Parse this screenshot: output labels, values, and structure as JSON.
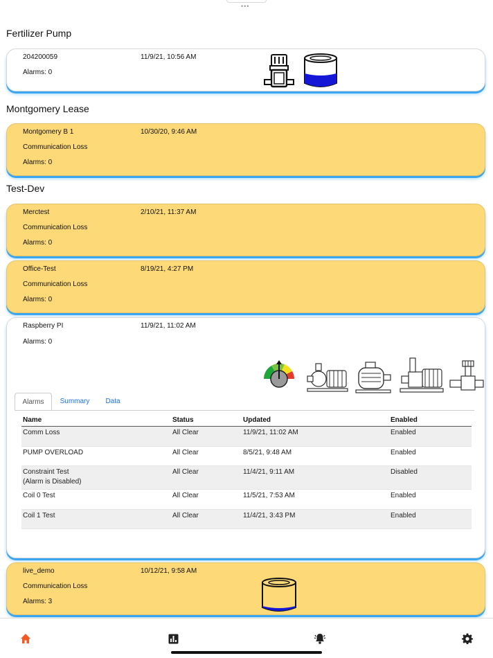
{
  "colors": {
    "warn_bg": "#fdd978",
    "accent": "#39a6ef",
    "nav_active": "#f15a24",
    "link": "#1a73e8"
  },
  "groups": [
    {
      "title": "Fertilizer Pump"
    },
    {
      "title": "Montgomery Lease"
    },
    {
      "title": "Test-Dev"
    }
  ],
  "devices": {
    "fertilizer": {
      "name": "204200059",
      "time": "11/9/21, 10:56 AM",
      "alarms": "Alarms: 0",
      "icons": [
        "vertical-pump-icon",
        "tank-icon"
      ]
    },
    "montgomery": {
      "name": "Montgomery B 1",
      "time": "10/30/20, 9:46 AM",
      "status": "Communication Loss",
      "alarms": "Alarms: 0"
    },
    "merctest": {
      "name": "Merctest",
      "time": "2/10/21, 11:37 AM",
      "status": "Communication Loss",
      "alarms": "Alarms: 0"
    },
    "office": {
      "name": "Office-Test",
      "time": "8/19/21, 4:27 PM",
      "status": "Communication Loss",
      "alarms": "Alarms: 0"
    },
    "raspberry": {
      "name": "Raspberry PI",
      "time": "11/9/21, 11:02 AM",
      "alarms": "Alarms: 0",
      "icons": [
        "gauge-icon",
        "centrifugal-pump-icon",
        "motor-icon",
        "skid-pump-icon",
        "valve-icon"
      ],
      "tabs": [
        "Alarms",
        "Summary",
        "Data"
      ],
      "active_tab": "Alarms",
      "table": {
        "headers": [
          "Name",
          "Status",
          "Updated",
          "Enabled"
        ],
        "rows": [
          {
            "name": "Comm Loss",
            "sub": "",
            "status": "All Clear",
            "updated": "11/9/21, 11:02 AM",
            "enabled": "Enabled"
          },
          {
            "name": "PUMP OVERLOAD",
            "sub": "",
            "status": "All Clear",
            "updated": "8/5/21, 9:48 AM",
            "enabled": "Enabled"
          },
          {
            "name": "Constraint Test",
            "sub": "(Alarm is Disabled)",
            "status": "All Clear",
            "updated": "11/4/21, 9:11 AM",
            "enabled": "Disabled"
          },
          {
            "name": "Coil 0 Test",
            "sub": "",
            "status": "All Clear",
            "updated": "11/5/21, 7:53 AM",
            "enabled": "Enabled"
          },
          {
            "name": "Coil 1 Test",
            "sub": "",
            "status": "All Clear",
            "updated": "11/4/21, 3:43 PM",
            "enabled": "Enabled"
          }
        ]
      }
    },
    "live_demo": {
      "name": "live_demo",
      "time": "10/12/21, 9:58 AM",
      "status": "Communication Loss",
      "alarms": "Alarms: 3",
      "icons": [
        "tank-icon"
      ]
    }
  },
  "nav": [
    {
      "icon": "home-icon",
      "active": true
    },
    {
      "icon": "chart-icon",
      "active": false
    },
    {
      "icon": "alarm-bell-icon",
      "active": false
    },
    {
      "icon": "gear-icon",
      "active": false
    }
  ]
}
